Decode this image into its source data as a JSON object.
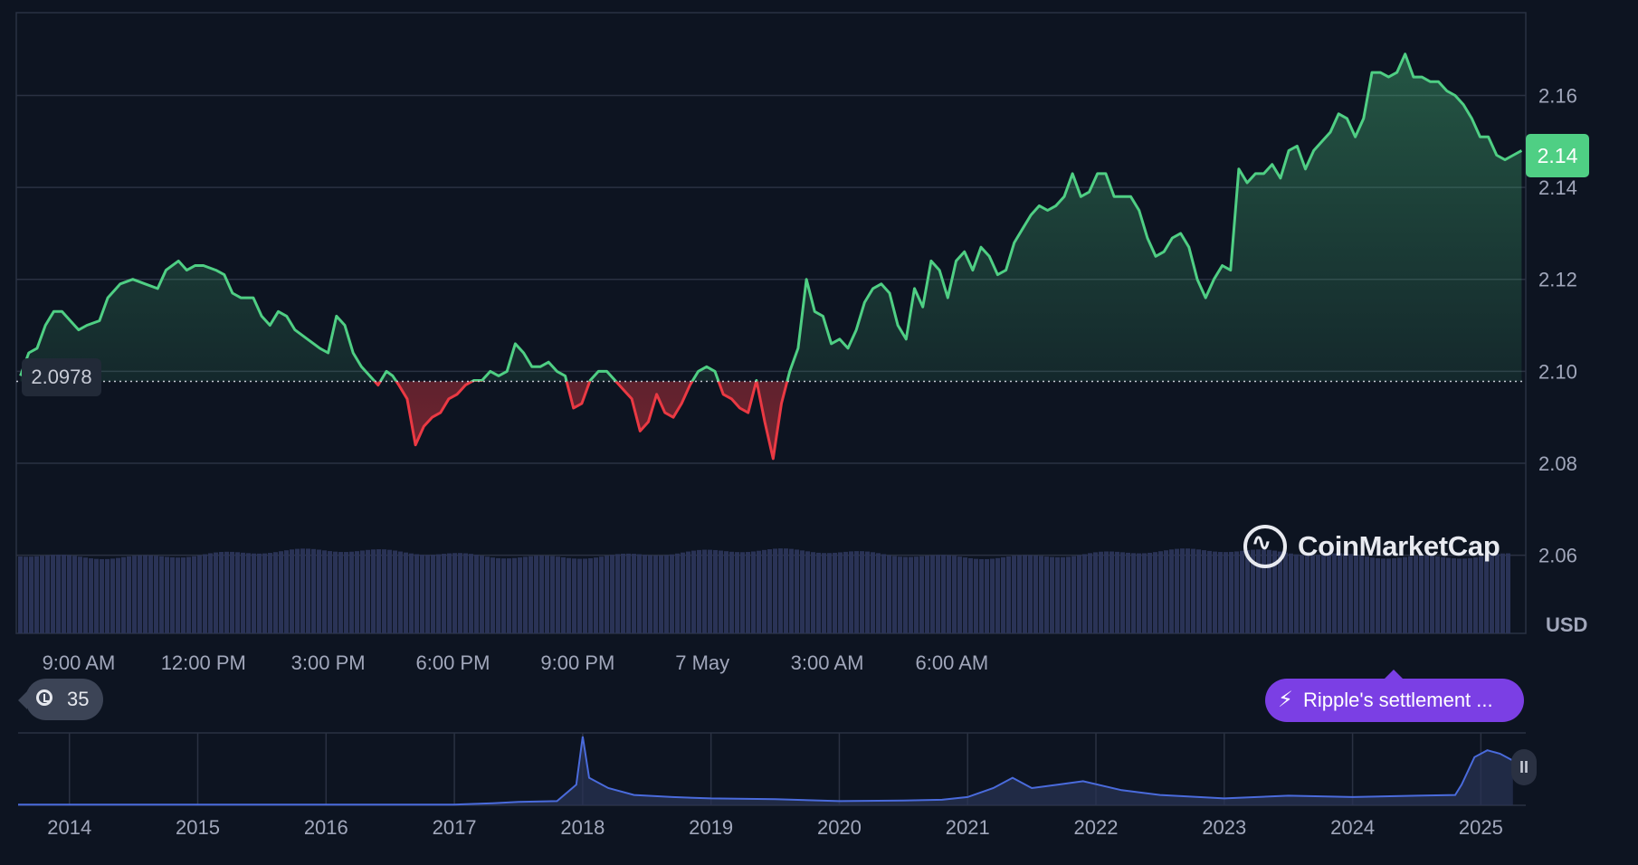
{
  "chart_data": [
    {
      "type": "area",
      "title": "",
      "ylabel": "",
      "currency_label": "USD",
      "ylim": [
        2.043,
        2.178
      ],
      "y_ticks": [
        "2.06",
        "2.08",
        "2.10",
        "2.12",
        "2.14",
        "2.16"
      ],
      "x_ticks": [
        "9:00 AM",
        "12:00 PM",
        "3:00 PM",
        "6:00 PM",
        "9:00 PM",
        "7 May",
        "3:00 AM",
        "6:00 AM"
      ],
      "x_tick_hours": [
        9,
        12,
        15,
        18,
        21,
        24,
        27,
        30
      ],
      "baseline_price": 2.0978,
      "baseline_label": "2.0978",
      "current_price_label": "2.14",
      "colors": {
        "up": "#4fcf84",
        "down": "#ea3943",
        "volume": "#2a3356",
        "grid": "#2a3142",
        "baseline": "#c7cbd6"
      },
      "price_points": [
        [
          7.6,
          2.099
        ],
        [
          7.8,
          2.104
        ],
        [
          8.0,
          2.105
        ],
        [
          8.2,
          2.11
        ],
        [
          8.4,
          2.113
        ],
        [
          8.6,
          2.113
        ],
        [
          8.8,
          2.111
        ],
        [
          9.0,
          2.109
        ],
        [
          9.2,
          2.11
        ],
        [
          9.5,
          2.111
        ],
        [
          9.7,
          2.116
        ],
        [
          10.0,
          2.119
        ],
        [
          10.3,
          2.12
        ],
        [
          10.6,
          2.119
        ],
        [
          10.9,
          2.118
        ],
        [
          11.1,
          2.122
        ],
        [
          11.4,
          2.124
        ],
        [
          11.6,
          2.122
        ],
        [
          11.8,
          2.123
        ],
        [
          12.0,
          2.123
        ],
        [
          12.3,
          2.122
        ],
        [
          12.5,
          2.121
        ],
        [
          12.7,
          2.117
        ],
        [
          12.9,
          2.116
        ],
        [
          13.2,
          2.116
        ],
        [
          13.4,
          2.112
        ],
        [
          13.6,
          2.11
        ],
        [
          13.8,
          2.113
        ],
        [
          14.0,
          2.112
        ],
        [
          14.2,
          2.109
        ],
        [
          14.5,
          2.107
        ],
        [
          14.8,
          2.105
        ],
        [
          15.0,
          2.104
        ],
        [
          15.2,
          2.112
        ],
        [
          15.4,
          2.11
        ],
        [
          15.6,
          2.104
        ],
        [
          15.8,
          2.101
        ],
        [
          16.0,
          2.099
        ],
        [
          16.2,
          2.097
        ],
        [
          16.4,
          2.1
        ],
        [
          16.55,
          2.099
        ],
        [
          16.7,
          2.097
        ],
        [
          16.9,
          2.094
        ],
        [
          17.1,
          2.084
        ],
        [
          17.3,
          2.088
        ],
        [
          17.5,
          2.09
        ],
        [
          17.7,
          2.091
        ],
        [
          17.9,
          2.094
        ],
        [
          18.1,
          2.095
        ],
        [
          18.3,
          2.097
        ],
        [
          18.5,
          2.098
        ],
        [
          18.7,
          2.098
        ],
        [
          18.9,
          2.1
        ],
        [
          19.1,
          2.099
        ],
        [
          19.3,
          2.1
        ],
        [
          19.5,
          2.106
        ],
        [
          19.7,
          2.104
        ],
        [
          19.9,
          2.101
        ],
        [
          20.1,
          2.101
        ],
        [
          20.3,
          2.102
        ],
        [
          20.5,
          2.1
        ],
        [
          20.7,
          2.099
        ],
        [
          20.9,
          2.092
        ],
        [
          21.1,
          2.093
        ],
        [
          21.3,
          2.098
        ],
        [
          21.5,
          2.1
        ],
        [
          21.7,
          2.1
        ],
        [
          21.9,
          2.098
        ],
        [
          22.1,
          2.096
        ],
        [
          22.3,
          2.094
        ],
        [
          22.5,
          2.087
        ],
        [
          22.7,
          2.089
        ],
        [
          22.9,
          2.095
        ],
        [
          23.1,
          2.091
        ],
        [
          23.3,
          2.09
        ],
        [
          23.5,
          2.093
        ],
        [
          23.7,
          2.097
        ],
        [
          23.9,
          2.1
        ],
        [
          24.1,
          2.101
        ],
        [
          24.3,
          2.1
        ],
        [
          24.5,
          2.095
        ],
        [
          24.7,
          2.094
        ],
        [
          24.9,
          2.092
        ],
        [
          25.1,
          2.091
        ],
        [
          25.3,
          2.098
        ],
        [
          25.5,
          2.089
        ],
        [
          25.7,
          2.081
        ],
        [
          25.9,
          2.093
        ],
        [
          26.1,
          2.1
        ],
        [
          26.3,
          2.105
        ],
        [
          26.5,
          2.12
        ],
        [
          26.7,
          2.113
        ],
        [
          26.9,
          2.112
        ],
        [
          27.1,
          2.106
        ],
        [
          27.3,
          2.107
        ],
        [
          27.5,
          2.105
        ],
        [
          27.7,
          2.109
        ],
        [
          27.9,
          2.115
        ],
        [
          28.1,
          2.118
        ],
        [
          28.3,
          2.119
        ],
        [
          28.5,
          2.117
        ],
        [
          28.7,
          2.11
        ],
        [
          28.9,
          2.107
        ],
        [
          29.1,
          2.118
        ],
        [
          29.3,
          2.114
        ],
        [
          29.5,
          2.124
        ],
        [
          29.7,
          2.122
        ],
        [
          29.9,
          2.116
        ],
        [
          30.1,
          2.124
        ],
        [
          30.3,
          2.126
        ],
        [
          30.5,
          2.122
        ],
        [
          30.7,
          2.127
        ],
        [
          30.9,
          2.125
        ],
        [
          31.1,
          2.121
        ],
        [
          31.3,
          2.122
        ],
        [
          31.5,
          2.128
        ],
        [
          31.7,
          2.131
        ],
        [
          31.9,
          2.134
        ],
        [
          32.1,
          2.136
        ],
        [
          32.3,
          2.135
        ],
        [
          32.5,
          2.136
        ],
        [
          32.7,
          2.138
        ],
        [
          32.9,
          2.143
        ],
        [
          33.1,
          2.138
        ],
        [
          33.3,
          2.139
        ],
        [
          33.5,
          2.143
        ],
        [
          33.7,
          2.143
        ],
        [
          33.9,
          2.138
        ],
        [
          34.1,
          2.138
        ],
        [
          34.3,
          2.138
        ],
        [
          34.5,
          2.135
        ],
        [
          34.7,
          2.129
        ],
        [
          34.9,
          2.125
        ],
        [
          35.1,
          2.126
        ],
        [
          35.3,
          2.129
        ],
        [
          35.5,
          2.13
        ],
        [
          35.7,
          2.127
        ],
        [
          35.9,
          2.12
        ],
        [
          36.1,
          2.116
        ],
        [
          36.3,
          2.12
        ],
        [
          36.5,
          2.123
        ],
        [
          36.7,
          2.122
        ],
        [
          36.9,
          2.144
        ],
        [
          37.1,
          2.141
        ],
        [
          37.3,
          2.143
        ],
        [
          37.5,
          2.143
        ],
        [
          37.7,
          2.145
        ],
        [
          37.9,
          2.142
        ],
        [
          38.1,
          2.148
        ],
        [
          38.3,
          2.149
        ],
        [
          38.5,
          2.144
        ],
        [
          38.7,
          2.148
        ],
        [
          38.9,
          2.15
        ],
        [
          39.1,
          2.152
        ],
        [
          39.3,
          2.156
        ],
        [
          39.5,
          2.155
        ],
        [
          39.7,
          2.151
        ],
        [
          39.9,
          2.155
        ],
        [
          40.1,
          2.165
        ],
        [
          40.3,
          2.165
        ],
        [
          40.5,
          2.164
        ],
        [
          40.7,
          2.165
        ],
        [
          40.9,
          2.169
        ],
        [
          41.1,
          2.164
        ],
        [
          41.3,
          2.164
        ],
        [
          41.5,
          2.163
        ],
        [
          41.7,
          2.163
        ],
        [
          41.9,
          2.161
        ],
        [
          42.1,
          2.16
        ],
        [
          42.3,
          2.158
        ],
        [
          42.5,
          2.155
        ],
        [
          42.7,
          2.151
        ],
        [
          42.9,
          2.151
        ],
        [
          43.1,
          2.147
        ],
        [
          43.3,
          2.146
        ],
        [
          43.5,
          2.147
        ],
        [
          43.7,
          2.148
        ]
      ]
    },
    {
      "type": "area",
      "title": "",
      "x_ticks": [
        "2014",
        "2015",
        "2016",
        "2017",
        "2018",
        "2019",
        "2020",
        "2021",
        "2022",
        "2023",
        "2024",
        "2025"
      ],
      "x_tick_years": [
        2014,
        2015,
        2016,
        2017,
        2018,
        2019,
        2020,
        2021,
        2022,
        2023,
        2024,
        2025
      ],
      "colors": {
        "line": "#4a6bdc"
      },
      "points": [
        [
          2013.6,
          0.01
        ],
        [
          2014.5,
          0.01
        ],
        [
          2015.5,
          0.01
        ],
        [
          2016.5,
          0.01
        ],
        [
          2017.0,
          0.01
        ],
        [
          2017.3,
          0.03
        ],
        [
          2017.5,
          0.05
        ],
        [
          2017.8,
          0.06
        ],
        [
          2017.95,
          0.3
        ],
        [
          2018.0,
          1.0
        ],
        [
          2018.05,
          0.4
        ],
        [
          2018.2,
          0.25
        ],
        [
          2018.4,
          0.15
        ],
        [
          2018.7,
          0.12
        ],
        [
          2019.0,
          0.1
        ],
        [
          2019.5,
          0.09
        ],
        [
          2020.0,
          0.06
        ],
        [
          2020.5,
          0.07
        ],
        [
          2020.8,
          0.08
        ],
        [
          2021.0,
          0.12
        ],
        [
          2021.2,
          0.25
        ],
        [
          2021.35,
          0.4
        ],
        [
          2021.5,
          0.25
        ],
        [
          2021.7,
          0.3
        ],
        [
          2021.9,
          0.35
        ],
        [
          2022.2,
          0.22
        ],
        [
          2022.5,
          0.15
        ],
        [
          2023.0,
          0.1
        ],
        [
          2023.5,
          0.14
        ],
        [
          2024.0,
          0.12
        ],
        [
          2024.5,
          0.14
        ],
        [
          2024.8,
          0.15
        ],
        [
          2024.85,
          0.3
        ],
        [
          2024.95,
          0.7
        ],
        [
          2025.05,
          0.8
        ],
        [
          2025.15,
          0.75
        ],
        [
          2025.25,
          0.65
        ]
      ]
    }
  ]
}
